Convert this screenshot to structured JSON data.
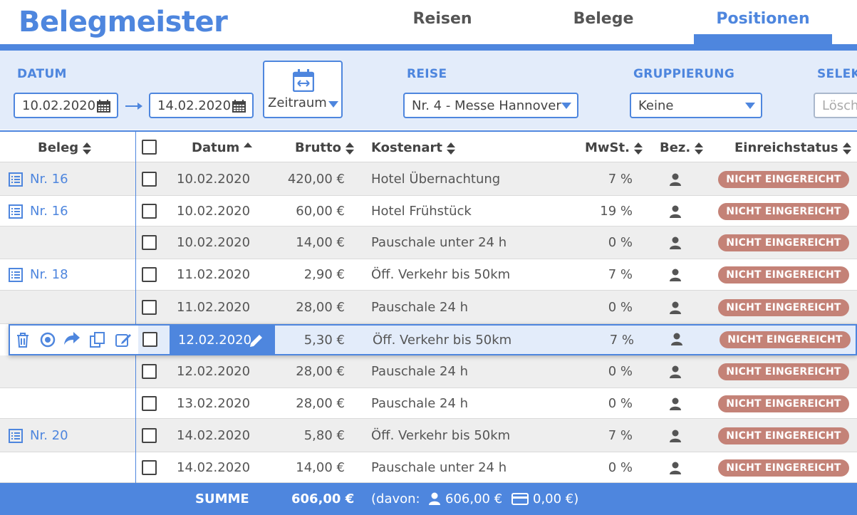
{
  "app": {
    "title": "Belegmeister"
  },
  "nav": {
    "tabs": [
      {
        "label": "Reisen"
      },
      {
        "label": "Belege"
      },
      {
        "label": "Positionen"
      }
    ]
  },
  "filters": {
    "datum_label": "DATUM",
    "date_from": "10.02.2020",
    "date_to": "14.02.2020",
    "zeitraum_label": "Zeitraum",
    "reise_label": "REISE",
    "reise_value": "Nr. 4 - Messe Hannover",
    "gruppierung_label": "GRUPPIERUNG",
    "gruppierung_value": "Keine",
    "selektion_label": "SELEK",
    "selektion_placeholder": "Lösch"
  },
  "table": {
    "headers": {
      "beleg": "Beleg",
      "datum": "Datum",
      "brutto": "Brutto",
      "kostenart": "Kostenart",
      "mwst": "MwSt.",
      "bez": "Bez.",
      "status": "Einreichstatus"
    },
    "rows": [
      {
        "beleg": "Nr. 16",
        "datum": "10.02.2020",
        "brutto": "420,00 €",
        "kostenart": "Hotel Übernachtung",
        "mwst": "7 %",
        "status": "NICHT EINGEREICHT"
      },
      {
        "beleg": "Nr. 16",
        "datum": "10.02.2020",
        "brutto": "60,00 €",
        "kostenart": "Hotel Frühstück",
        "mwst": "19 %",
        "status": "NICHT EINGEREICHT"
      },
      {
        "beleg": "",
        "datum": "10.02.2020",
        "brutto": "14,00 €",
        "kostenart": "Pauschale unter 24 h",
        "mwst": "0 %",
        "status": "NICHT EINGEREICHT"
      },
      {
        "beleg": "Nr. 18",
        "datum": "11.02.2020",
        "brutto": "2,90 €",
        "kostenart": "Öff. Verkehr bis 50km",
        "mwst": "7 %",
        "status": "NICHT EINGEREICHT"
      },
      {
        "beleg": "",
        "datum": "11.02.2020",
        "brutto": "28,00 €",
        "kostenart": "Pauschale 24 h",
        "mwst": "0 %",
        "status": "NICHT EINGEREICHT"
      },
      {
        "beleg": "",
        "datum": "12.02.2020",
        "brutto": "5,30 €",
        "kostenart": "Öff. Verkehr bis 50km",
        "mwst": "7 %",
        "status": "NICHT EINGEREICHT"
      },
      {
        "beleg": "",
        "datum": "12.02.2020",
        "brutto": "28,00 €",
        "kostenart": "Pauschale 24 h",
        "mwst": "0 %",
        "status": "NICHT EINGEREICHT"
      },
      {
        "beleg": "",
        "datum": "13.02.2020",
        "brutto": "28,00 €",
        "kostenart": "Pauschale 24 h",
        "mwst": "0 %",
        "status": "NICHT EINGEREICHT"
      },
      {
        "beleg": "Nr. 20",
        "datum": "14.02.2020",
        "brutto": "5,80 €",
        "kostenart": "Öff. Verkehr bis 50km",
        "mwst": "7 %",
        "status": "NICHT EINGEREICHT"
      },
      {
        "beleg": "",
        "datum": "14.02.2020",
        "brutto": "14,00 €",
        "kostenart": "Pauschale unter 24 h",
        "mwst": "0 %",
        "status": "NICHT EINGEREICHT"
      }
    ],
    "selected_row_index": 5
  },
  "footer": {
    "summe_label": "SUMME",
    "summe_value": "606,00 €",
    "davon_prefix": "(davon:",
    "person_amount": "606,00 €",
    "card_amount": "0,00 €)"
  },
  "colors": {
    "accent": "#4e86de",
    "badge": "#c48277",
    "filter_bg": "#e3ecfa"
  }
}
